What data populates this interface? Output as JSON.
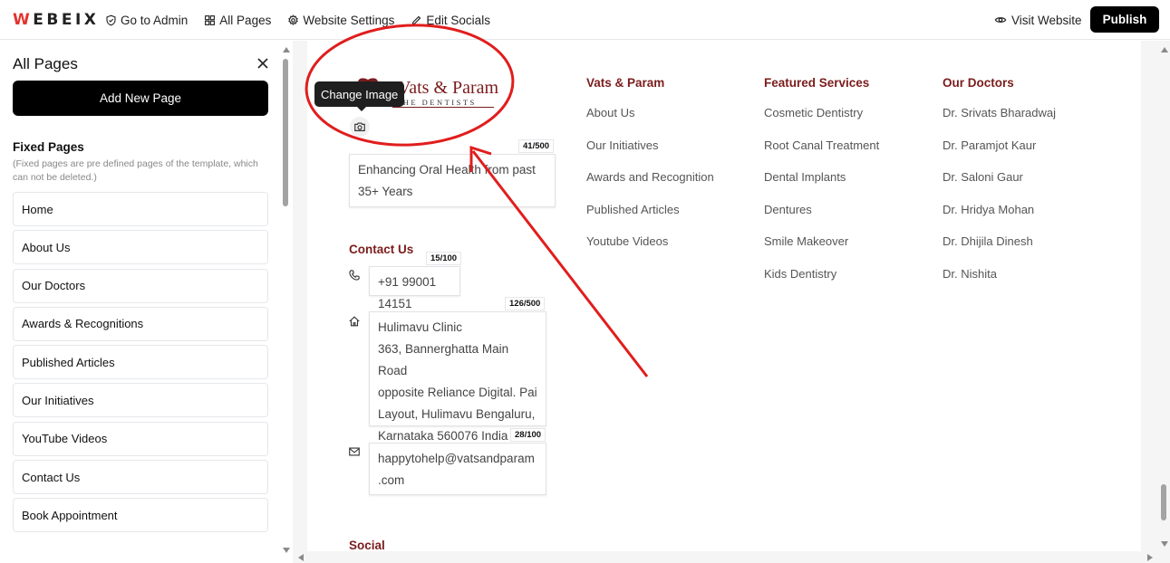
{
  "topbar": {
    "logo_first": "W",
    "logo_rest": "EBEIX",
    "nav": [
      {
        "label": "Go to Admin",
        "icon": "shield-check-icon"
      },
      {
        "label": "All Pages",
        "icon": "grid-icon"
      },
      {
        "label": "Website Settings",
        "icon": "gear-icon"
      },
      {
        "label": "Edit Socials",
        "icon": "pencil-icon"
      }
    ],
    "visit_label": "Visit Website",
    "publish_label": "Publish"
  },
  "sidebar": {
    "title": "All Pages",
    "add_button": "Add New Page",
    "fixed_title": "Fixed Pages",
    "fixed_desc": "(Fixed pages are pre defined pages of the template, which can not be deleted.)",
    "pages": [
      "Home",
      "About Us",
      "Our Doctors",
      "Awards & Recognitions",
      "Published Articles",
      "Our Initiatives",
      "YouTube Videos",
      "Contact Us",
      "Book Appointment"
    ]
  },
  "footer": {
    "brand_name": "Vats & Param",
    "brand_sub": "THE DENTISTS",
    "tooltip": "Change Image",
    "tagline_counter": "41/500",
    "tagline": "Enhancing Oral Health from past 35+ Years",
    "contact_title": "Contact Us",
    "phone_counter": "15/100",
    "phone": "+91 99001 14151",
    "address_counter": "126/500",
    "address_lines": [
      "Hulimavu Clinic",
      "363, Bannerghatta Main Road",
      "opposite Reliance Digital. Pai",
      "Layout, Hulimavu Bengaluru,",
      "Karnataka 560076 India"
    ],
    "email_counter": "28/100",
    "email_lines": [
      "happytohelp@vatsandparam",
      ".com"
    ],
    "social_title": "Social",
    "columns": [
      {
        "title": "Vats & Param",
        "links": [
          "About Us",
          "Our Initiatives",
          "Awards and Recognition",
          "Published Articles",
          "Youtube Videos"
        ]
      },
      {
        "title": "Featured Services",
        "links": [
          "Cosmetic Dentistry",
          "Root Canal Treatment",
          "Dental Implants",
          "Dentures",
          "Smile Makeover",
          "Kids Dentistry"
        ]
      },
      {
        "title": "Our Doctors",
        "links": [
          "Dr. Srivats Bharadwaj",
          "Dr. Paramjot Kaur",
          "Dr. Saloni Gaur",
          "Dr. Hridya Mohan",
          "Dr. Dhijila Dinesh",
          "Dr. Nishita"
        ]
      }
    ]
  },
  "colors": {
    "accent": "#7b1c1c",
    "annotation": "#e11d1d",
    "primary_button": "#000000"
  }
}
